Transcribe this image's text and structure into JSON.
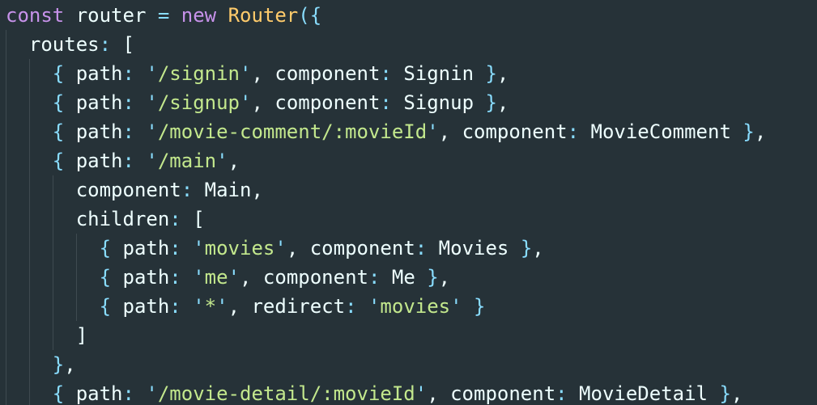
{
  "editor": {
    "language": "javascript",
    "theme_colors": {
      "background": "#263238",
      "keyword": "#c792ea",
      "class": "#ffcb6b",
      "punctuation": "#89ddff",
      "string": "#c3e88d",
      "text": "#eeffff"
    },
    "lines": [
      {
        "indent": 0,
        "tokens": [
          {
            "t": "kw",
            "v": "const"
          },
          {
            "t": "id",
            "v": " router "
          },
          {
            "t": "op",
            "v": "="
          },
          {
            "t": "id",
            "v": " "
          },
          {
            "t": "kw",
            "v": "new"
          },
          {
            "t": "id",
            "v": " "
          },
          {
            "t": "cls",
            "v": "Router"
          },
          {
            "t": "punc",
            "v": "({"
          }
        ]
      },
      {
        "indent": 1,
        "tokens": [
          {
            "t": "prop",
            "v": "routes"
          },
          {
            "t": "colon",
            "v": ":"
          },
          {
            "t": "id",
            "v": " "
          },
          {
            "t": "id",
            "v": "["
          }
        ]
      },
      {
        "indent": 2,
        "tokens": [
          {
            "t": "punc",
            "v": "{"
          },
          {
            "t": "id",
            "v": " "
          },
          {
            "t": "prop",
            "v": "path"
          },
          {
            "t": "colon",
            "v": ":"
          },
          {
            "t": "id",
            "v": " "
          },
          {
            "t": "q",
            "v": "'"
          },
          {
            "t": "str",
            "v": "/signin"
          },
          {
            "t": "q",
            "v": "'"
          },
          {
            "t": "id",
            "v": ", "
          },
          {
            "t": "prop",
            "v": "component"
          },
          {
            "t": "colon",
            "v": ":"
          },
          {
            "t": "id",
            "v": " Signin "
          },
          {
            "t": "punc",
            "v": "}"
          },
          {
            "t": "id",
            "v": ","
          }
        ]
      },
      {
        "indent": 2,
        "tokens": [
          {
            "t": "punc",
            "v": "{"
          },
          {
            "t": "id",
            "v": " "
          },
          {
            "t": "prop",
            "v": "path"
          },
          {
            "t": "colon",
            "v": ":"
          },
          {
            "t": "id",
            "v": " "
          },
          {
            "t": "q",
            "v": "'"
          },
          {
            "t": "str",
            "v": "/signup"
          },
          {
            "t": "q",
            "v": "'"
          },
          {
            "t": "id",
            "v": ", "
          },
          {
            "t": "prop",
            "v": "component"
          },
          {
            "t": "colon",
            "v": ":"
          },
          {
            "t": "id",
            "v": " Signup "
          },
          {
            "t": "punc",
            "v": "}"
          },
          {
            "t": "id",
            "v": ","
          }
        ]
      },
      {
        "indent": 2,
        "tokens": [
          {
            "t": "punc",
            "v": "{"
          },
          {
            "t": "id",
            "v": " "
          },
          {
            "t": "prop",
            "v": "path"
          },
          {
            "t": "colon",
            "v": ":"
          },
          {
            "t": "id",
            "v": " "
          },
          {
            "t": "q",
            "v": "'"
          },
          {
            "t": "str",
            "v": "/movie-comment/:movieId"
          },
          {
            "t": "q",
            "v": "'"
          },
          {
            "t": "id",
            "v": ", "
          },
          {
            "t": "prop",
            "v": "component"
          },
          {
            "t": "colon",
            "v": ":"
          },
          {
            "t": "id",
            "v": " MovieComment "
          },
          {
            "t": "punc",
            "v": "}"
          },
          {
            "t": "id",
            "v": ","
          }
        ]
      },
      {
        "indent": 2,
        "tokens": [
          {
            "t": "punc",
            "v": "{"
          },
          {
            "t": "id",
            "v": " "
          },
          {
            "t": "prop",
            "v": "path"
          },
          {
            "t": "colon",
            "v": ":"
          },
          {
            "t": "id",
            "v": " "
          },
          {
            "t": "q",
            "v": "'"
          },
          {
            "t": "str",
            "v": "/main"
          },
          {
            "t": "q",
            "v": "'"
          },
          {
            "t": "id",
            "v": ","
          }
        ]
      },
      {
        "indent": 3,
        "tokens": [
          {
            "t": "prop",
            "v": "component"
          },
          {
            "t": "colon",
            "v": ":"
          },
          {
            "t": "id",
            "v": " Main,"
          }
        ]
      },
      {
        "indent": 3,
        "tokens": [
          {
            "t": "prop",
            "v": "children"
          },
          {
            "t": "colon",
            "v": ":"
          },
          {
            "t": "id",
            "v": " ["
          }
        ]
      },
      {
        "indent": 4,
        "tokens": [
          {
            "t": "punc",
            "v": "{"
          },
          {
            "t": "id",
            "v": " "
          },
          {
            "t": "prop",
            "v": "path"
          },
          {
            "t": "colon",
            "v": ":"
          },
          {
            "t": "id",
            "v": " "
          },
          {
            "t": "q",
            "v": "'"
          },
          {
            "t": "str",
            "v": "movies"
          },
          {
            "t": "q",
            "v": "'"
          },
          {
            "t": "id",
            "v": ", "
          },
          {
            "t": "prop",
            "v": "component"
          },
          {
            "t": "colon",
            "v": ":"
          },
          {
            "t": "id",
            "v": " Movies "
          },
          {
            "t": "punc",
            "v": "}"
          },
          {
            "t": "id",
            "v": ","
          }
        ]
      },
      {
        "indent": 4,
        "tokens": [
          {
            "t": "punc",
            "v": "{"
          },
          {
            "t": "id",
            "v": " "
          },
          {
            "t": "prop",
            "v": "path"
          },
          {
            "t": "colon",
            "v": ":"
          },
          {
            "t": "id",
            "v": " "
          },
          {
            "t": "q",
            "v": "'"
          },
          {
            "t": "str",
            "v": "me"
          },
          {
            "t": "q",
            "v": "'"
          },
          {
            "t": "id",
            "v": ", "
          },
          {
            "t": "prop",
            "v": "component"
          },
          {
            "t": "colon",
            "v": ":"
          },
          {
            "t": "id",
            "v": " Me "
          },
          {
            "t": "punc",
            "v": "}"
          },
          {
            "t": "id",
            "v": ","
          }
        ]
      },
      {
        "indent": 4,
        "tokens": [
          {
            "t": "punc",
            "v": "{"
          },
          {
            "t": "id",
            "v": " "
          },
          {
            "t": "prop",
            "v": "path"
          },
          {
            "t": "colon",
            "v": ":"
          },
          {
            "t": "id",
            "v": " "
          },
          {
            "t": "q",
            "v": "'"
          },
          {
            "t": "str",
            "v": "*"
          },
          {
            "t": "q",
            "v": "'"
          },
          {
            "t": "id",
            "v": ", "
          },
          {
            "t": "prop",
            "v": "redirect"
          },
          {
            "t": "colon",
            "v": ":"
          },
          {
            "t": "id",
            "v": " "
          },
          {
            "t": "q",
            "v": "'"
          },
          {
            "t": "str",
            "v": "movies"
          },
          {
            "t": "q",
            "v": "'"
          },
          {
            "t": "id",
            "v": " "
          },
          {
            "t": "punc",
            "v": "}"
          }
        ]
      },
      {
        "indent": 3,
        "tokens": [
          {
            "t": "id",
            "v": "]"
          }
        ]
      },
      {
        "indent": 2,
        "tokens": [
          {
            "t": "punc",
            "v": "}"
          },
          {
            "t": "id",
            "v": ","
          }
        ]
      },
      {
        "indent": 2,
        "tokens": [
          {
            "t": "punc",
            "v": "{"
          },
          {
            "t": "id",
            "v": " "
          },
          {
            "t": "prop",
            "v": "path"
          },
          {
            "t": "colon",
            "v": ":"
          },
          {
            "t": "id",
            "v": " "
          },
          {
            "t": "q",
            "v": "'"
          },
          {
            "t": "str",
            "v": "/movie-detail/:movieId"
          },
          {
            "t": "q",
            "v": "'"
          },
          {
            "t": "id",
            "v": ", "
          },
          {
            "t": "prop",
            "v": "component"
          },
          {
            "t": "colon",
            "v": ":"
          },
          {
            "t": "id",
            "v": " MovieDetail "
          },
          {
            "t": "punc",
            "v": "}"
          },
          {
            "t": "id",
            "v": ","
          }
        ]
      }
    ]
  }
}
